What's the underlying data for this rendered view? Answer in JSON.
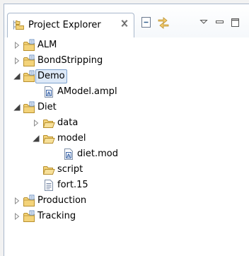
{
  "view": {
    "title": "Project Explorer",
    "close_icon": "close-x-icon",
    "toolbar_icons": [
      "collapse-all-icon",
      "link-with-editor-icon",
      "view-menu-icon",
      "minimize-icon",
      "maximize-icon"
    ]
  },
  "tree": {
    "items": [
      {
        "label": "ALM",
        "type": "project",
        "expanded": false
      },
      {
        "label": "BondStripping",
        "type": "project",
        "expanded": false
      },
      {
        "label": "Demo",
        "type": "project",
        "expanded": true,
        "selected": true
      },
      {
        "label": "AModel.ampl",
        "type": "ampl-file"
      },
      {
        "label": "Diet",
        "type": "project",
        "expanded": true
      },
      {
        "label": "data",
        "type": "folder",
        "expanded": false
      },
      {
        "label": "model",
        "type": "folder",
        "expanded": true
      },
      {
        "label": "diet.mod",
        "type": "ampl-file"
      },
      {
        "label": "script",
        "type": "folder"
      },
      {
        "label": "fort.15",
        "type": "text-file"
      },
      {
        "label": "Production",
        "type": "project",
        "expanded": false
      },
      {
        "label": "Tracking",
        "type": "project",
        "expanded": false
      }
    ]
  },
  "colors": {
    "folder": "#e8c25a",
    "selection_bg": "#dde9f8",
    "selection_border": "#7da2ce",
    "border": "#a9b8cc"
  }
}
